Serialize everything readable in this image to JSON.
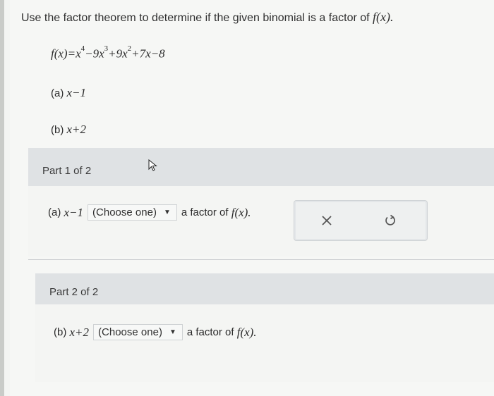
{
  "question": {
    "text": "Use the factor theorem to determine if the given binomial is a factor of",
    "fx": "f(x)."
  },
  "function": {
    "lhs": "f(x)=x",
    "e1": "4",
    "t2": "−9x",
    "e2": "3",
    "t3": "+9x",
    "e3": "2",
    "rest": "+7x−8"
  },
  "items": {
    "a_label": "(a)",
    "a_expr": "x−1",
    "b_label": "(b)",
    "b_expr": "x+2"
  },
  "part1": {
    "header": "Part 1 of 2",
    "label": "(a)",
    "expr": "x−1",
    "select_value": "(Choose one)",
    "suffix": "a factor of",
    "fx": "f(x)."
  },
  "part2": {
    "header": "Part 2 of 2",
    "label": "(b)",
    "expr": "x+2",
    "select_value": "(Choose one)",
    "suffix": "a factor of",
    "fx": "f(x)."
  },
  "actions": {
    "clear_icon": "×",
    "undo_icon": "↺"
  },
  "icons": [
    "caret-down-icon",
    "close-icon",
    "undo-icon",
    "mouse-cursor-icon"
  ]
}
